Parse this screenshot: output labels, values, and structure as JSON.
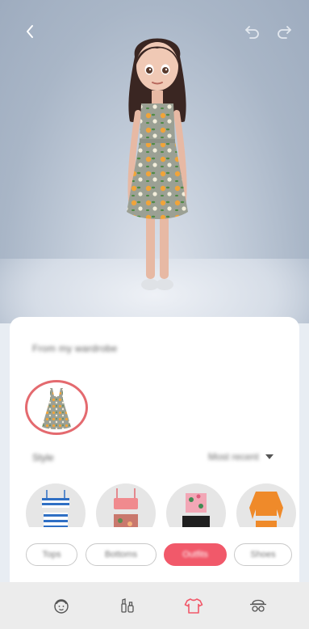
{
  "header": {
    "back_icon": "chevron-left-icon",
    "undo_icon": "undo-icon",
    "redo_icon": "redo-icon"
  },
  "wardrobe": {
    "title": "From my wardrobe",
    "items": [
      {
        "icon": "floral-dress-icon",
        "selected": true
      }
    ]
  },
  "style": {
    "label": "Style",
    "sort_value": "Most recent",
    "sort_icon": "caret-down-icon"
  },
  "outfit_items": [
    {
      "icon": "striped-top-icon"
    },
    {
      "icon": "pink-top-icon"
    },
    {
      "icon": "floral-top-icon"
    },
    {
      "icon": "orange-top-icon"
    }
  ],
  "categories": [
    {
      "label": "Tops",
      "active": false
    },
    {
      "label": "Bottoms",
      "active": false
    },
    {
      "label": "Outfits",
      "active": true
    },
    {
      "label": "Shoes",
      "active": false
    }
  ],
  "bottom_nav": [
    {
      "icon": "face-icon",
      "active": false
    },
    {
      "icon": "makeup-icon",
      "active": false
    },
    {
      "icon": "tshirt-icon",
      "active": true
    },
    {
      "icon": "accessories-icon",
      "active": false
    }
  ],
  "colors": {
    "accent": "#f1596a",
    "selection_ring": "#e46a6f",
    "stage_bg": "#a9b6c7",
    "nav_bg": "#ececec"
  }
}
